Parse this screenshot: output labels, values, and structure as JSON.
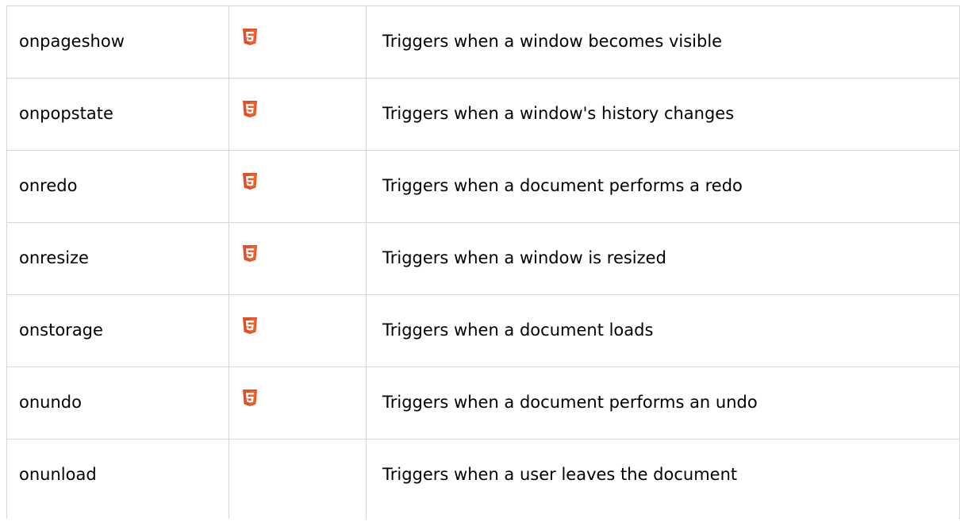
{
  "rows": [
    {
      "name": "onpageshow",
      "html5": true,
      "description": "Triggers when a window becomes visible"
    },
    {
      "name": "onpopstate",
      "html5": true,
      "description": "Triggers when a window's history changes"
    },
    {
      "name": "onredo",
      "html5": true,
      "description": "Triggers when a document performs a redo"
    },
    {
      "name": "onresize",
      "html5": true,
      "description": "Triggers when a window is resized"
    },
    {
      "name": "onstorage",
      "html5": true,
      "description": "Triggers when a document loads"
    },
    {
      "name": "onundo",
      "html5": true,
      "description": "Triggers when a document performs an undo"
    },
    {
      "name": "onunload",
      "html5": false,
      "description": "Triggers when a user leaves the document"
    }
  ],
  "icons": {
    "html5": "html5-icon"
  },
  "colors": {
    "html5_orange": "#e44d26",
    "html5_light": "#f16529",
    "border": "#d6d6d6"
  }
}
